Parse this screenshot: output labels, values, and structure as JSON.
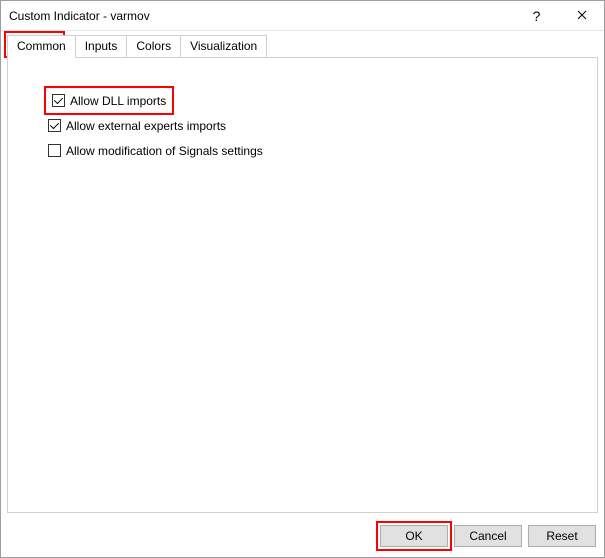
{
  "window": {
    "title": "Custom Indicator - varmov",
    "help_tooltip": "?",
    "close_tooltip": "Close"
  },
  "tabs": [
    {
      "label": "Common",
      "active": true
    },
    {
      "label": "Inputs",
      "active": false
    },
    {
      "label": "Colors",
      "active": false
    },
    {
      "label": "Visualization",
      "active": false
    }
  ],
  "options": [
    {
      "label": "Allow DLL imports",
      "checked": true,
      "highlighted": true
    },
    {
      "label": "Allow external experts imports",
      "checked": true,
      "highlighted": false
    },
    {
      "label": "Allow modification of Signals settings",
      "checked": false,
      "highlighted": false
    }
  ],
  "buttons": {
    "ok": "OK",
    "cancel": "Cancel",
    "reset": "Reset"
  },
  "highlights": {
    "tab_common": true,
    "ok_button": true
  }
}
